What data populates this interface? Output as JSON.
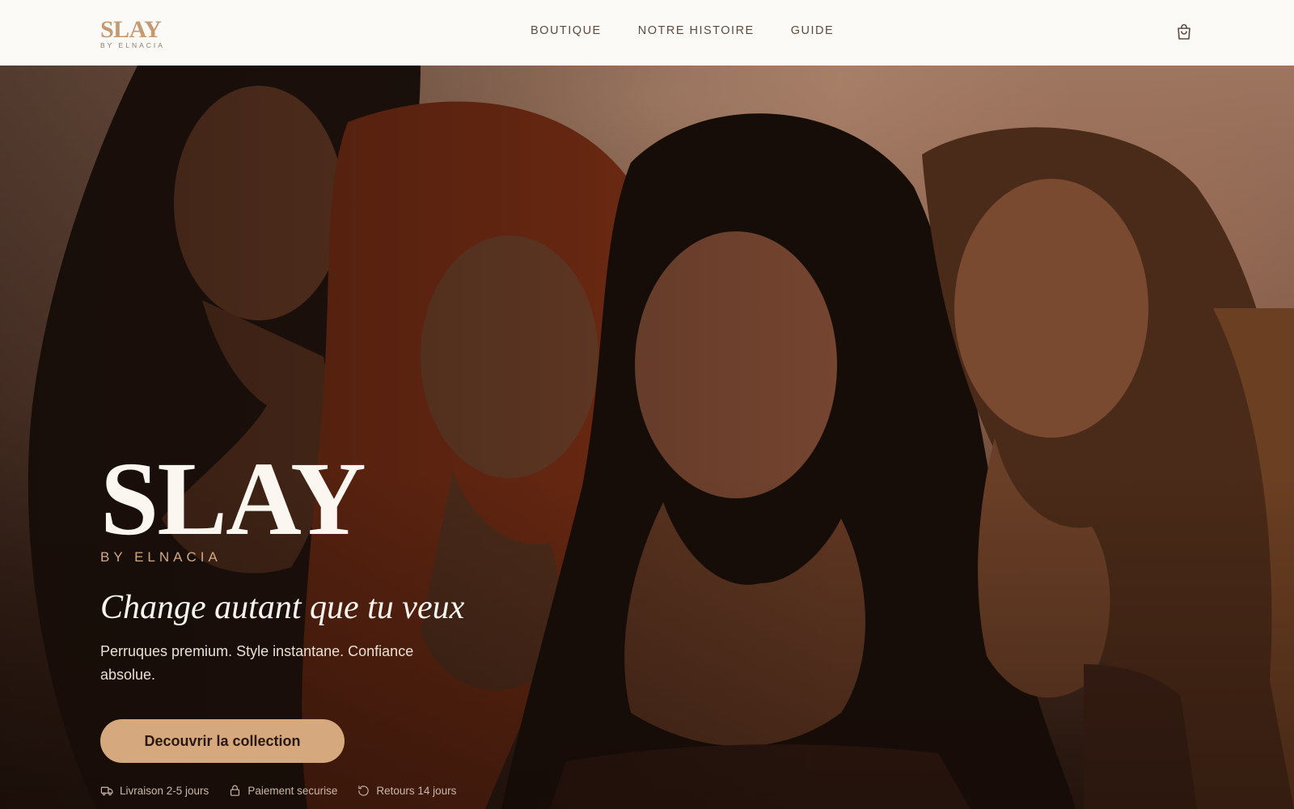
{
  "header": {
    "logo": {
      "main": "SLAY",
      "sub": "BY ELNACIA"
    },
    "nav": [
      {
        "label": "BOUTIQUE"
      },
      {
        "label": "NOTRE HISTOIRE"
      },
      {
        "label": "GUIDE"
      }
    ],
    "cart_icon": "shopping-bag-icon"
  },
  "hero": {
    "title": "SLAY",
    "subtitle": "BY ELNACIA",
    "tagline": "Change autant que tu veux",
    "description": "Perruques premium. Style instantane. Confiance absolue.",
    "cta_label": "Decouvrir la collection",
    "trust": [
      {
        "icon": "truck-icon",
        "label": "Livraison 2-5 jours"
      },
      {
        "icon": "lock-icon",
        "label": "Paiement securise"
      },
      {
        "icon": "return-icon",
        "label": "Retours 14 jours"
      }
    ]
  },
  "colors": {
    "header_bg": "#fcfaf6",
    "accent": "#d6a87e",
    "logo": "#c39a74",
    "hero_text": "#fbf6ef"
  }
}
